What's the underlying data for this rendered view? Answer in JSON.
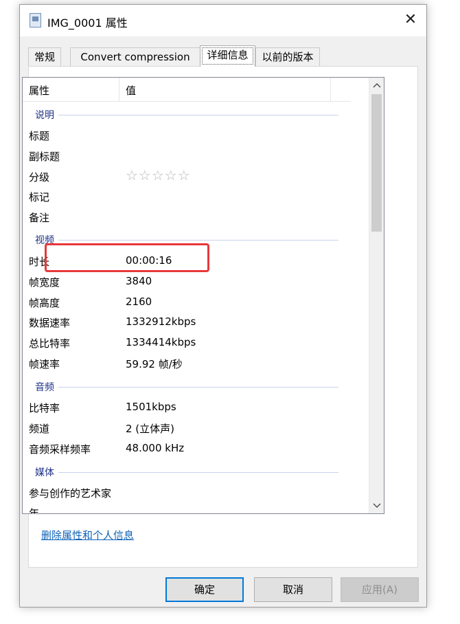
{
  "window": {
    "title": "IMG_0001 属性",
    "icon": "file-icon",
    "close_glyph": "✕"
  },
  "tabs": [
    {
      "label": "常规",
      "active": false
    },
    {
      "label": "Convert compression",
      "active": false
    },
    {
      "label": "详细信息",
      "active": true
    },
    {
      "label": "以前的版本",
      "active": false
    }
  ],
  "table": {
    "col_property": "属性",
    "col_value": "值"
  },
  "groups": {
    "description": "说明",
    "video": "视频",
    "audio": "音频",
    "media": "媒体"
  },
  "rows": {
    "title": {
      "k": "标题",
      "v": ""
    },
    "subtitle": {
      "k": "副标题",
      "v": ""
    },
    "rating": {
      "k": "分级",
      "v": "☆☆☆☆☆",
      "stars": 0
    },
    "tags": {
      "k": "标记",
      "v": ""
    },
    "comments": {
      "k": "备注",
      "v": ""
    },
    "duration": {
      "k": "时长",
      "v": "00:00:16"
    },
    "frame_width": {
      "k": "帧宽度",
      "v": "3840"
    },
    "frame_height": {
      "k": "帧高度",
      "v": "2160"
    },
    "data_rate": {
      "k": "数据速率",
      "v": "1332912kbps"
    },
    "total_bitrate": {
      "k": "总比特率",
      "v": "1334414kbps"
    },
    "frame_rate": {
      "k": "帧速率",
      "v": "59.92 帧/秒"
    },
    "audio_bitrate": {
      "k": "比特率",
      "v": "1501kbps"
    },
    "channels": {
      "k": "频道",
      "v": "2 (立体声)"
    },
    "sample_rate": {
      "k": "音频采样频率",
      "v": "48.000 kHz"
    },
    "contributing_artists": {
      "k": "参与创作的艺术家",
      "v": ""
    },
    "year_partial": {
      "k": "年",
      "v": ""
    }
  },
  "link": "删除属性和个人信息",
  "buttons": {
    "ok": "确定",
    "cancel": "取消",
    "apply": "应用(A)"
  },
  "colors": {
    "highlight_box": "#e8383a",
    "group_header": "#1e3287",
    "link": "#0e63b6",
    "default_button_border": "#0078d7"
  }
}
